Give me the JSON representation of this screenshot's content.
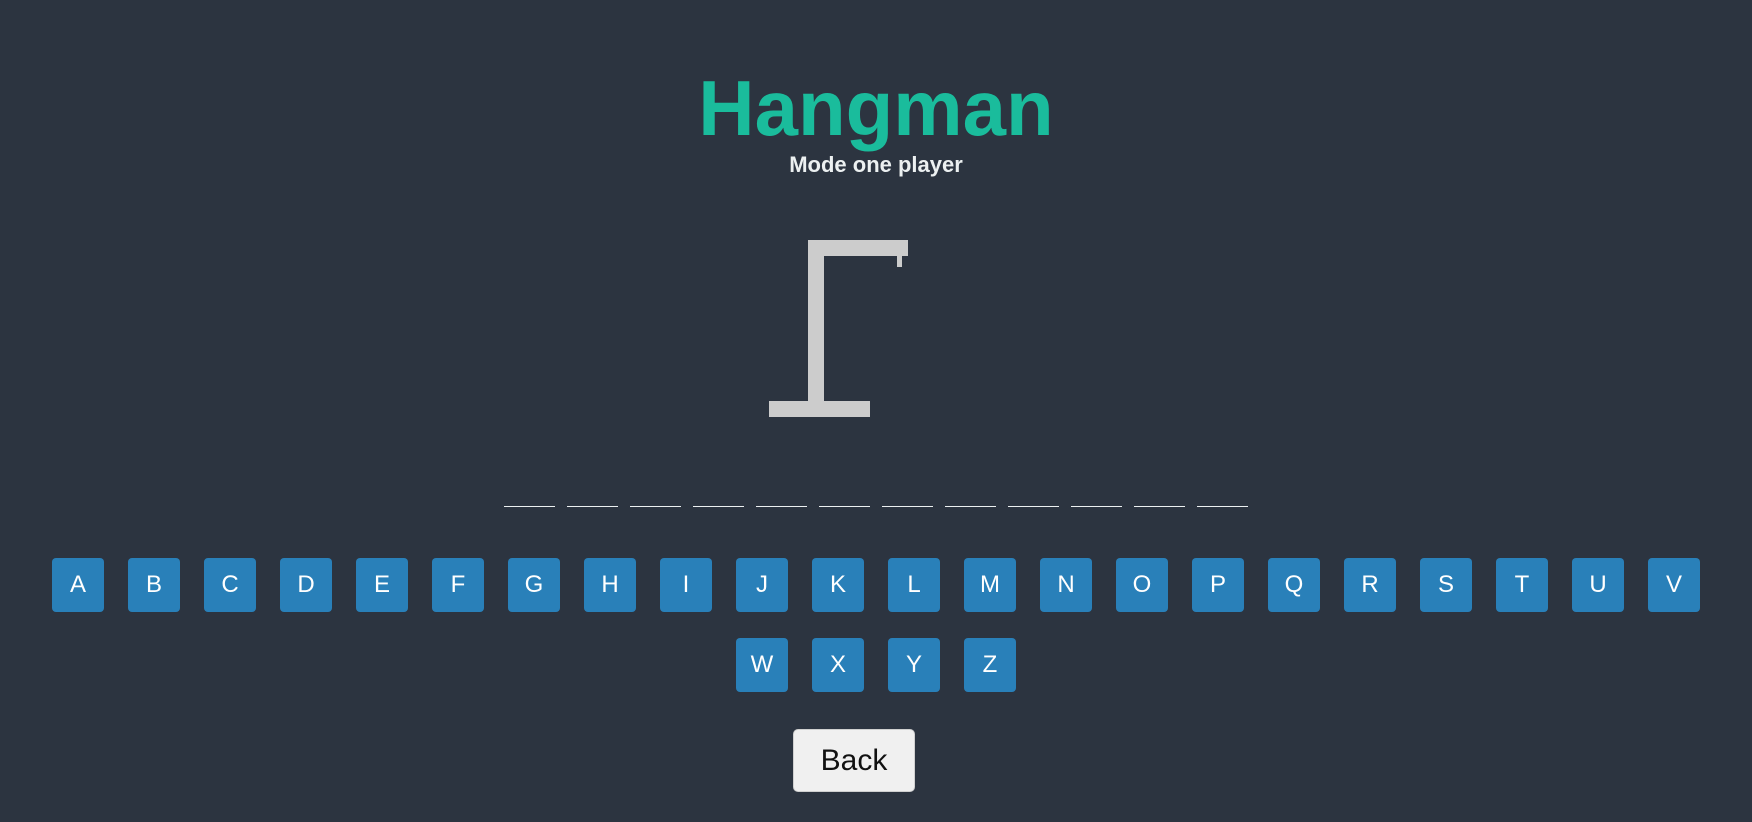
{
  "header": {
    "title": "Hangman",
    "subtitle": "Mode one player"
  },
  "colors": {
    "background": "#2c3440",
    "title": "#1abc9c",
    "letter_button": "#2980b9",
    "gallows": "#cccccc",
    "back_button": "#f0f0f0"
  },
  "word": {
    "length": 12,
    "slots": [
      "",
      "",
      "",
      "",
      "",
      "",
      "",
      "",
      "",
      "",
      "",
      ""
    ]
  },
  "keyboard": {
    "letters": [
      "A",
      "B",
      "C",
      "D",
      "E",
      "F",
      "G",
      "H",
      "I",
      "J",
      "K",
      "L",
      "M",
      "N",
      "O",
      "P",
      "Q",
      "R",
      "S",
      "T",
      "U",
      "V",
      "W",
      "X",
      "Y",
      "Z"
    ]
  },
  "back_label": "Back"
}
